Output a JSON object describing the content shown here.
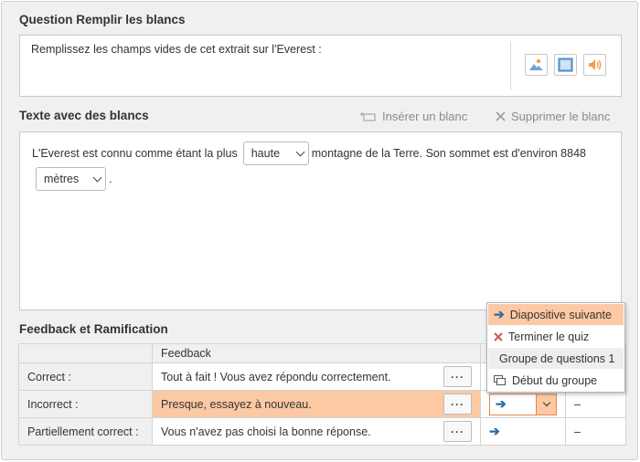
{
  "question": {
    "heading": "Question Remplir les blancs",
    "prompt": "Remplissez les champs vides de cet extrait sur l'Everest :",
    "media_buttons": [
      "image-icon",
      "video-icon",
      "audio-icon"
    ]
  },
  "blanks_section": {
    "heading": "Texte avec des blancs",
    "insert_label": "Insérer un blanc",
    "delete_label": "Supprimer le blanc",
    "text_before": "L'Everest est connu comme étant la plus",
    "blank1_value": "haute",
    "text_middle": "montagne de la Terre. Son sommet est d'environ 8848",
    "blank2_value": "mètres",
    "text_after": "."
  },
  "feedback": {
    "heading": "Feedback et Ramification",
    "column_header": "Feedback",
    "rows": [
      {
        "label": "Correct :",
        "text": "Tout à fait ! Vous avez répondu correctement.",
        "dash": ""
      },
      {
        "label": "Incorrect :",
        "text": "Presque, essayez à nouveau.",
        "dash": "–"
      },
      {
        "label": "Partiellement correct :",
        "text": "Vous n'avez pas choisi la bonne réponse.",
        "dash": "–"
      }
    ],
    "dots_label": "···"
  },
  "branch_menu": {
    "items": [
      "Diapositive suivante",
      "Terminer le quiz",
      "Groupe de questions 1",
      "Début du groupe"
    ],
    "selected_index": 0
  },
  "colors": {
    "highlight": "#fcc9a4",
    "accent_border": "#e5864e",
    "arrow": "#2e6da4",
    "close_x": "#d9534f"
  }
}
